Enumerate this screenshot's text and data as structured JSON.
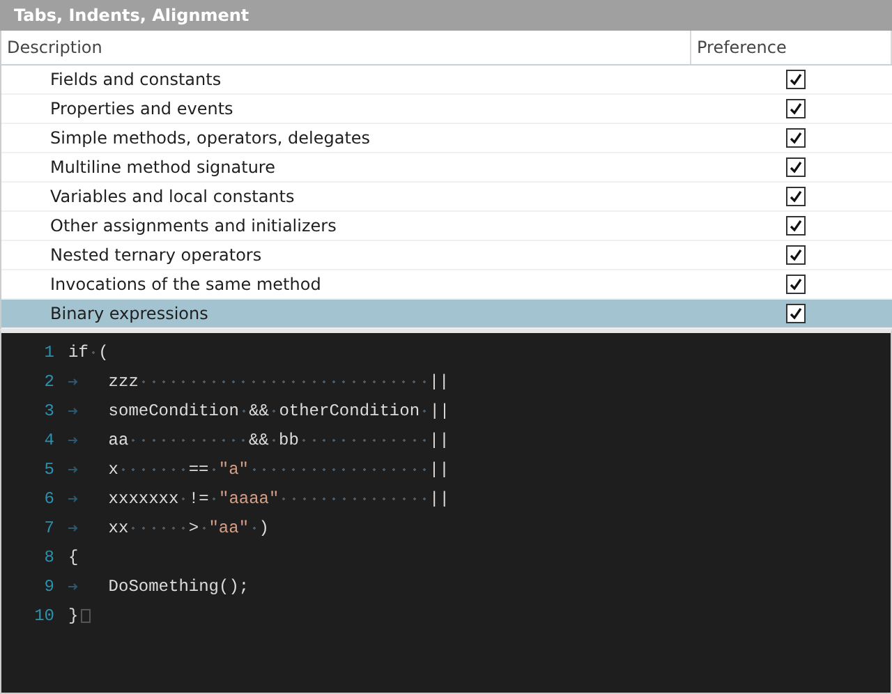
{
  "panel": {
    "title": "Tabs, Indents, Alignment"
  },
  "table": {
    "columns": [
      "Description",
      "Preference"
    ],
    "rows": [
      {
        "label": "Fields and constants",
        "checked": true,
        "selected": false
      },
      {
        "label": "Properties and events",
        "checked": true,
        "selected": false
      },
      {
        "label": "Simple methods, operators, delegates",
        "checked": true,
        "selected": false
      },
      {
        "label": "Multiline method signature",
        "checked": true,
        "selected": false
      },
      {
        "label": "Variables and local constants",
        "checked": true,
        "selected": false
      },
      {
        "label": "Other assignments and initializers",
        "checked": true,
        "selected": false
      },
      {
        "label": "Nested ternary operators",
        "checked": true,
        "selected": false
      },
      {
        "label": "Invocations of the same method",
        "checked": true,
        "selected": false
      },
      {
        "label": "Binary expressions",
        "checked": true,
        "selected": true
      }
    ]
  },
  "editor": {
    "lines": [
      {
        "number": "1",
        "tab": false,
        "tokens": [
          {
            "kind": "code",
            "text": "if ("
          }
        ]
      },
      {
        "number": "2",
        "tab": true,
        "tokens": [
          {
            "kind": "code",
            "text": "zzz                             ||"
          }
        ]
      },
      {
        "number": "3",
        "tab": true,
        "tokens": [
          {
            "kind": "code",
            "text": "someCondition && otherCondition ||"
          }
        ]
      },
      {
        "number": "4",
        "tab": true,
        "tokens": [
          {
            "kind": "code",
            "text": "aa            && bb             ||"
          }
        ]
      },
      {
        "number": "5",
        "tab": true,
        "tokens": [
          {
            "kind": "code",
            "text": "x       =="
          },
          {
            "kind": "string",
            "text": "\"a\""
          },
          {
            "kind": "code",
            "text": "                 ||"
          }
        ]
      },
      {
        "number": "6",
        "tab": true,
        "tokens": [
          {
            "kind": "code",
            "text": "xxxxxxx !="
          },
          {
            "kind": "string",
            "text": "\"aaaa\""
          },
          {
            "kind": "code",
            "text": "              ||"
          }
        ]
      },
      {
        "number": "7",
        "tab": true,
        "tokens": [
          {
            "kind": "code",
            "text": "xx      >"
          },
          {
            "kind": "string",
            "text": "\"aa\""
          },
          {
            "kind": "code",
            "text": ")"
          }
        ]
      },
      {
        "number": "8",
        "tab": false,
        "tokens": [
          {
            "kind": "code",
            "text": "{"
          }
        ]
      },
      {
        "number": "9",
        "tab": true,
        "tokens": [
          {
            "kind": "code",
            "text": "DoSomething();"
          }
        ]
      },
      {
        "number": "10",
        "tab": false,
        "end_marker": true,
        "tokens": [
          {
            "kind": "code",
            "text": "}"
          }
        ]
      }
    ]
  }
}
